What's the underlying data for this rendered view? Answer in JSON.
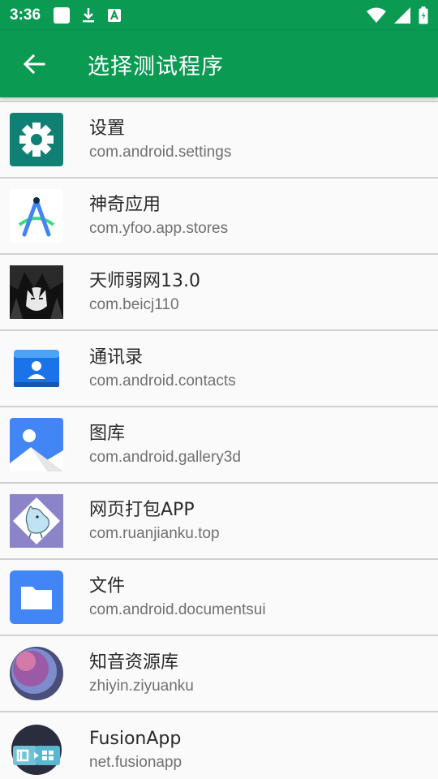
{
  "status_bar": {
    "time": "3:36",
    "icons": [
      "notification-square-icon",
      "download-icon",
      "font-icon",
      "wifi-icon",
      "signal-icon",
      "battery-icon"
    ]
  },
  "app_bar": {
    "title": "选择测试程序",
    "back_icon": "arrow-back-icon"
  },
  "colors": {
    "primary": "#0a9a52",
    "divider": "#cfcfcf",
    "name_text": "#2a2a2a",
    "pkg_text": "#707070"
  },
  "apps": [
    {
      "name": "设置",
      "package": "com.android.settings",
      "icon": "settings-gear-icon"
    },
    {
      "name": "神奇应用",
      "package": "com.yfoo.app.stores",
      "icon": "compass-a-icon"
    },
    {
      "name": "天师弱网13.0",
      "package": "com.beicj110",
      "icon": "anime-avatar-icon"
    },
    {
      "name": "通讯录",
      "package": "com.android.contacts",
      "icon": "contacts-icon"
    },
    {
      "name": "图库",
      "package": "com.android.gallery3d",
      "icon": "gallery-icon"
    },
    {
      "name": "网页打包APP",
      "package": "com.ruanjianku.top",
      "icon": "moomin-icon"
    },
    {
      "name": "文件",
      "package": "com.android.documentsui",
      "icon": "folder-icon"
    },
    {
      "name": "知音资源库",
      "package": "zhiyin.ziyuanku",
      "icon": "purple-circle-icon"
    },
    {
      "name": "FusionApp",
      "package": "net.fusionapp",
      "icon": "fusionapp-icon"
    }
  ]
}
